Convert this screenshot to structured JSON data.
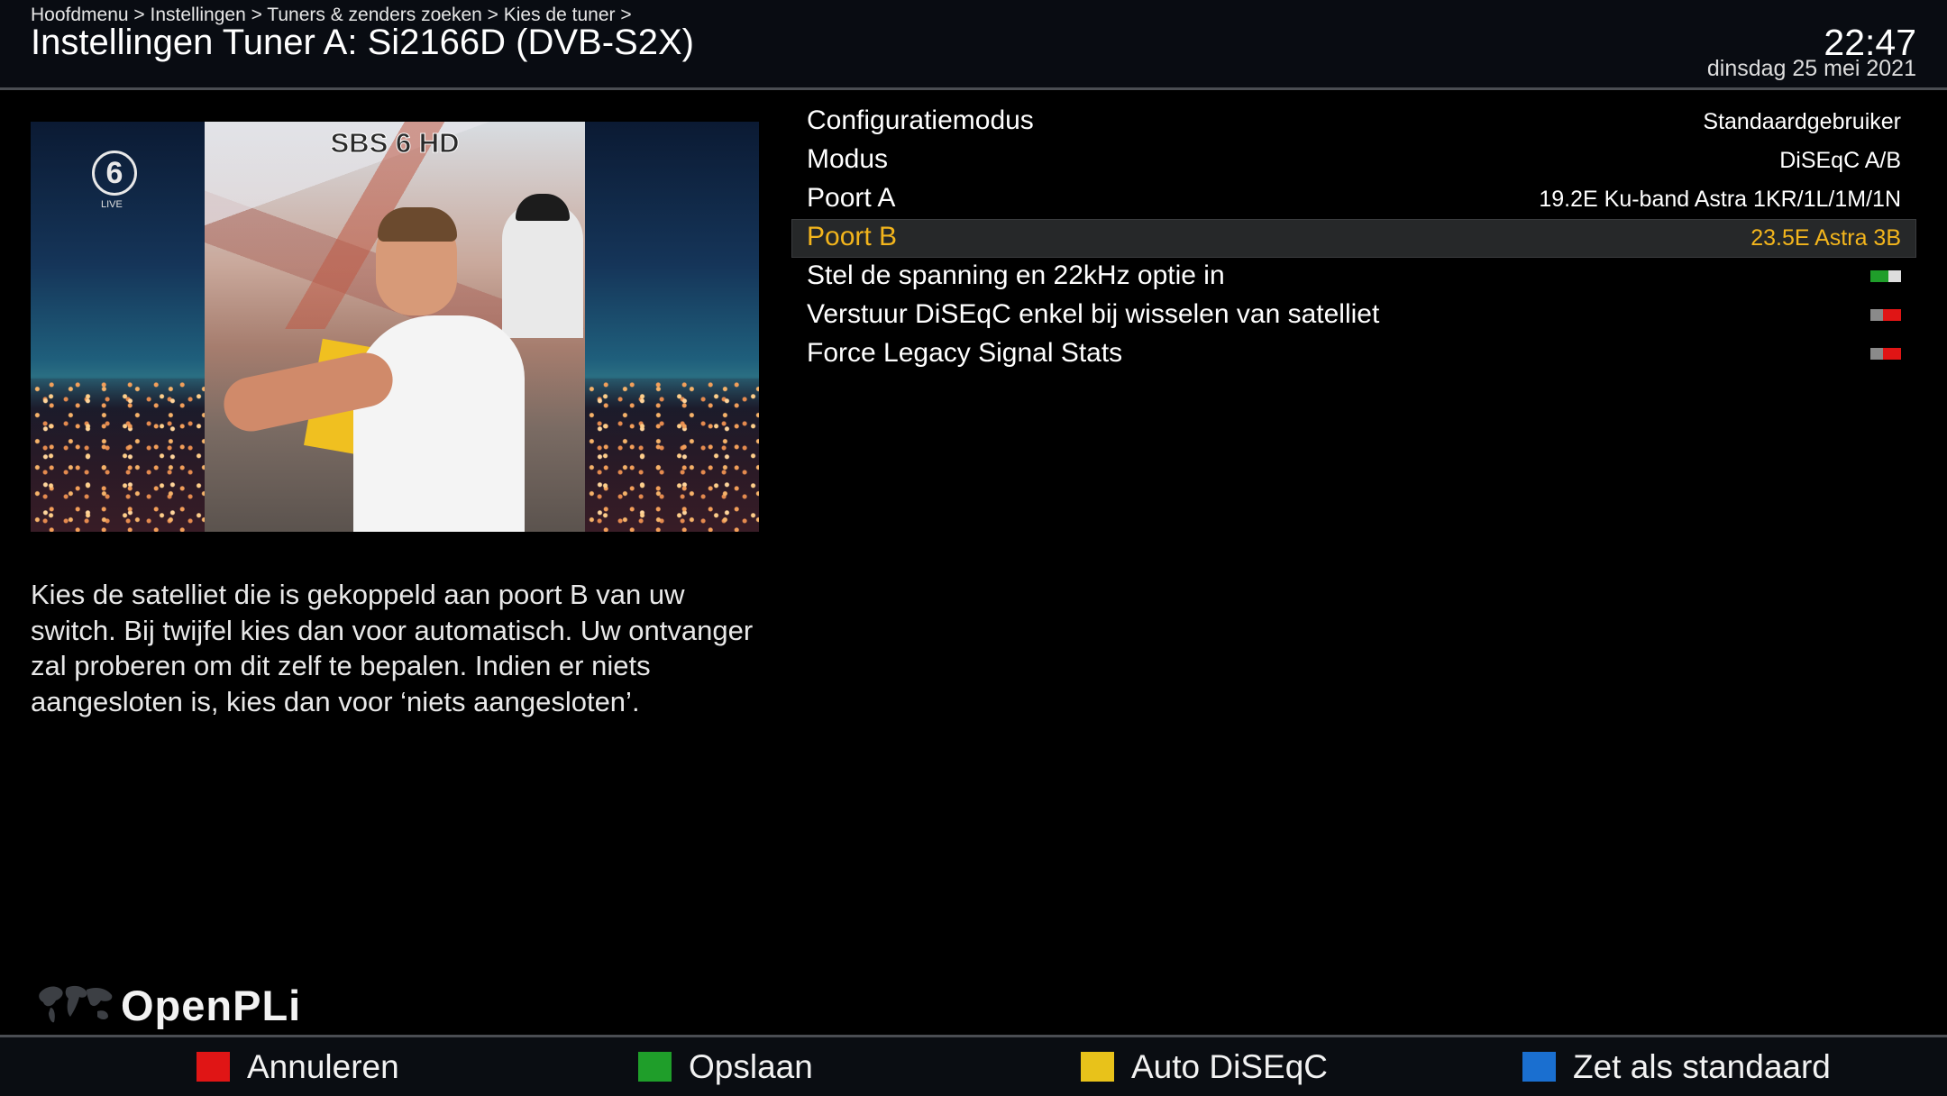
{
  "header": {
    "breadcrumb": "Hoofdmenu > Instellingen > Tuners & zenders zoeken > Kies de tuner >",
    "title": "Instellingen Tuner A: Si2166D (DVB-S2X)",
    "time": "22:47",
    "date": "dinsdag 25 mei 2021"
  },
  "preview": {
    "channel_name": "SBS 6 HD",
    "logo_glyph": "6",
    "logo_sub": "LIVE"
  },
  "description": "Kies de satelliet die is gekoppeld aan poort B van uw switch. Bij twijfel kies dan voor automatisch. Uw ontvanger zal proberen om dit zelf te bepalen. Indien er niets aangesloten is, kies dan voor ‘niets aangesloten’.",
  "settings": [
    {
      "label": "Configuratiemodus",
      "value": "Standaardgebruiker"
    },
    {
      "label": "Modus",
      "value": "DiSEqC A/B"
    },
    {
      "label": "Poort A",
      "value": "19.2E Ku-band Astra 1KR/1L/1M/1N"
    },
    {
      "label": "Poort B",
      "value": "23.5E Astra 3B",
      "selected": true
    },
    {
      "label": "Stel de spanning en 22kHz optie in",
      "toggle": "on"
    },
    {
      "label": "Verstuur DiSEqC enkel bij wisselen van satelliet",
      "toggle": "off"
    },
    {
      "label": "Force Legacy Signal Stats",
      "toggle": "off"
    }
  ],
  "branding": {
    "logo_text": "OpenPLi"
  },
  "footer": {
    "red_label": "Annuleren",
    "green_label": "Opslaan",
    "yellow_label": "Auto DiSEqC",
    "blue_label": "Zet als standaard"
  },
  "colors": {
    "accent_selected": "#f3b51c",
    "red": "#e01515",
    "green": "#1f9e2a",
    "yellow": "#e8c21a",
    "blue": "#1a6fd0"
  }
}
